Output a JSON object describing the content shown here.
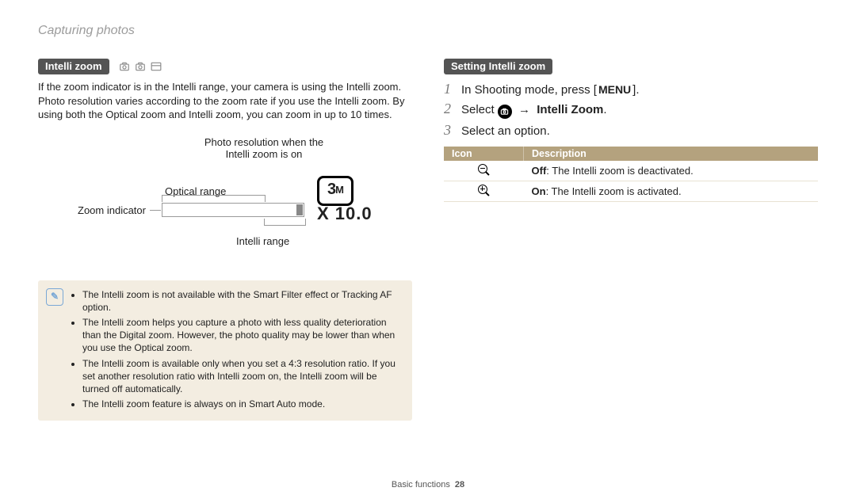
{
  "breadcrumb": "Capturing photos",
  "left": {
    "section_title": "Intelli zoom",
    "body": "If the zoom indicator is in the Intelli range, your camera is using the Intelli zoom. Photo resolution varies according to the zoom rate if you use the Intelli zoom. By using both the Optical zoom and Intelli zoom, you can zoom in up to 10 times.",
    "diagram": {
      "photo_res": "Photo resolution when the Intelli zoom is on",
      "optical": "Optical range",
      "zoom_ind": "Zoom indicator",
      "intelli": "Intelli range",
      "badge_a": "3",
      "badge_b": "M",
      "zoom_value": "X 10.0"
    },
    "note_icon": "✎",
    "notes": [
      "The Intelli zoom is not available with the Smart Filter effect or Tracking AF option.",
      "The Intelli zoom helps you capture a photo with less quality deterioration than the Digital zoom. However, the photo quality may be lower than when you use the Optical zoom.",
      "The Intelli zoom is available only when you set a 4:3 resolution ratio. If you set another resolution ratio with Intelli zoom on, the Intelli zoom will be turned off automatically.",
      "The Intelli zoom feature is always on in Smart Auto mode."
    ]
  },
  "right": {
    "section_title": "Setting Intelli zoom",
    "steps": {
      "s1_a": "In Shooting mode, press [",
      "s1_b": "MENU",
      "s1_c": "].",
      "s2_a": "Select ",
      "s2_b": " → ",
      "s2_c": "Intelli Zoom",
      "s2_d": ".",
      "s3": "Select an option."
    },
    "table": {
      "head_icon": "Icon",
      "head_desc": "Description",
      "row1_label": "Off",
      "row1_text": ": The Intelli zoom is deactivated.",
      "row2_label": "On",
      "row2_text": ": The Intelli zoom is activated."
    }
  },
  "footer": {
    "section": "Basic functions",
    "page": "28"
  }
}
